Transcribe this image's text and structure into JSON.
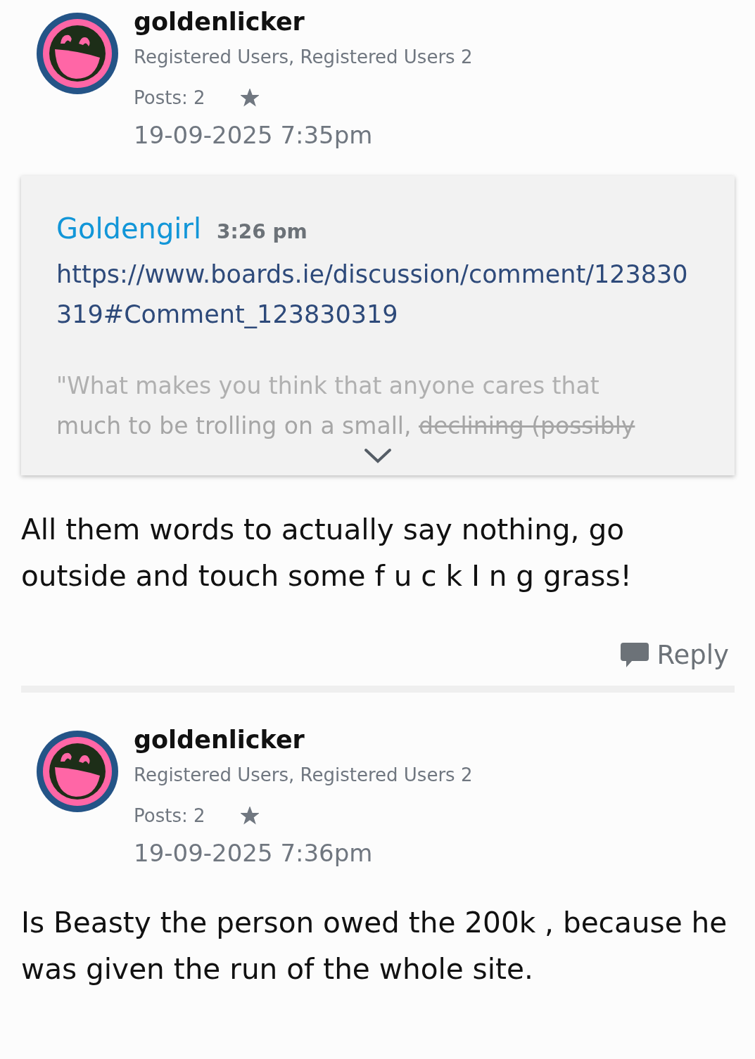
{
  "posts": [
    {
      "author": "goldenlicker",
      "roles": "Registered Users, Registered Users 2",
      "post_count": "Posts: 2",
      "date": "19-09-2025 7:35pm",
      "quote": {
        "author": "Goldengirl",
        "time": "3:26 pm",
        "link": "https://www.boards.ie/discussion/comment/123830319#Comment_123830319",
        "expanded": false,
        "lines": [
          [
            {
              "text": "\"What makes you think that anyone cares that",
              "struck": false
            }
          ],
          [
            {
              "text": "much to be trolling on a small, ",
              "struck": false
            },
            {
              "text": "declining (possibly",
              "struck": true
            }
          ]
        ]
      },
      "body": "All them words to actually say nothing, go outside and touch some f u c k I n g grass!",
      "reply": "Reply"
    },
    {
      "author": "goldenlicker",
      "roles": "Registered Users, Registered Users 2",
      "post_count": "Posts: 2",
      "date": "19-09-2025 7:36pm",
      "body": "Is Beasty the person owed the 200k , because he was given the run of the whole site."
    }
  ]
}
